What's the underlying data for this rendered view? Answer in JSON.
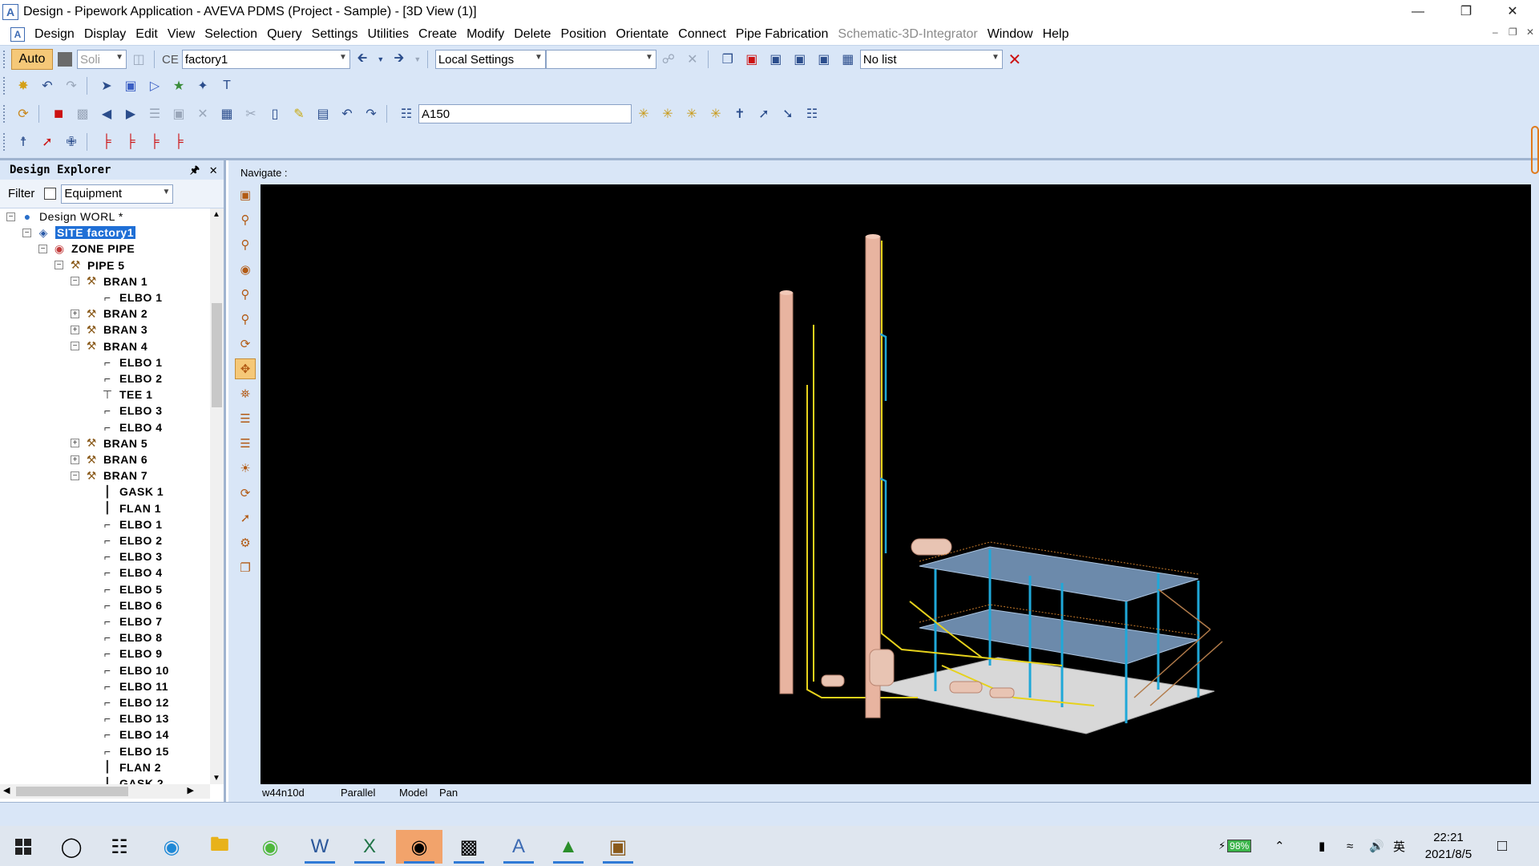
{
  "window": {
    "title": "Design - Pipework Application  - AVEVA PDMS (Project - Sample) - [3D View (1)]",
    "app_icon_letter": "A"
  },
  "menu": {
    "items": [
      "Design",
      "Display",
      "Edit",
      "View",
      "Selection",
      "Query",
      "Settings",
      "Utilities",
      "Create",
      "Modify",
      "Delete",
      "Position",
      "Orientate",
      "Connect",
      "Pipe Fabrication",
      "Schematic-3D-Integrator",
      "Window",
      "Help"
    ],
    "disabled": [
      "Schematic-3D-Integrator"
    ]
  },
  "toolbar": {
    "auto_label": "Auto",
    "solid_value": "Soli",
    "ce_label": "CE",
    "ce_value": "factory1",
    "local_settings_value": "Local Settings",
    "empty_combo_value": "",
    "list_value": "No list",
    "spec_value": "A150"
  },
  "explorer": {
    "title": "Design Explorer",
    "filter_label": "Filter",
    "filter_value": "Equipment",
    "tree": [
      {
        "label": "Design WORL *",
        "level": 0,
        "exp": "-",
        "icon": "globe",
        "plain": true
      },
      {
        "label": "SITE factory1",
        "level": 1,
        "exp": "-",
        "icon": "site",
        "selected": true
      },
      {
        "label": "ZONE PIPE",
        "level": 2,
        "exp": "-",
        "icon": "zone"
      },
      {
        "label": "PIPE 5",
        "level": 3,
        "exp": "-",
        "icon": "pipe"
      },
      {
        "label": "BRAN 1",
        "level": 4,
        "exp": "-",
        "icon": "pipe"
      },
      {
        "label": "ELBO 1",
        "level": 5,
        "exp": "",
        "icon": "elbo"
      },
      {
        "label": "BRAN 2",
        "level": 4,
        "exp": "+",
        "icon": "pipe"
      },
      {
        "label": "BRAN 3",
        "level": 4,
        "exp": "+",
        "icon": "pipe"
      },
      {
        "label": "BRAN 4",
        "level": 4,
        "exp": "-",
        "icon": "pipe"
      },
      {
        "label": "ELBO 1",
        "level": 5,
        "exp": "",
        "icon": "elbo"
      },
      {
        "label": "ELBO 2",
        "level": 5,
        "exp": "",
        "icon": "elbo"
      },
      {
        "label": "TEE 1",
        "level": 5,
        "exp": "",
        "icon": "tee"
      },
      {
        "label": "ELBO 3",
        "level": 5,
        "exp": "",
        "icon": "elbo"
      },
      {
        "label": "ELBO 4",
        "level": 5,
        "exp": "",
        "icon": "elbo"
      },
      {
        "label": "BRAN 5",
        "level": 4,
        "exp": "+",
        "icon": "pipe"
      },
      {
        "label": "BRAN 6",
        "level": 4,
        "exp": "+",
        "icon": "pipe"
      },
      {
        "label": "BRAN 7",
        "level": 4,
        "exp": "-",
        "icon": "pipe"
      },
      {
        "label": "GASK 1",
        "level": 5,
        "exp": "",
        "icon": "gask"
      },
      {
        "label": "FLAN 1",
        "level": 5,
        "exp": "",
        "icon": "gask"
      },
      {
        "label": "ELBO 1",
        "level": 5,
        "exp": "",
        "icon": "elbo"
      },
      {
        "label": "ELBO 2",
        "level": 5,
        "exp": "",
        "icon": "elbo"
      },
      {
        "label": "ELBO 3",
        "level": 5,
        "exp": "",
        "icon": "elbo"
      },
      {
        "label": "ELBO 4",
        "level": 5,
        "exp": "",
        "icon": "elbo"
      },
      {
        "label": "ELBO 5",
        "level": 5,
        "exp": "",
        "icon": "elbo"
      },
      {
        "label": "ELBO 6",
        "level": 5,
        "exp": "",
        "icon": "elbo"
      },
      {
        "label": "ELBO 7",
        "level": 5,
        "exp": "",
        "icon": "elbo"
      },
      {
        "label": "ELBO 8",
        "level": 5,
        "exp": "",
        "icon": "elbo"
      },
      {
        "label": "ELBO 9",
        "level": 5,
        "exp": "",
        "icon": "elbo"
      },
      {
        "label": "ELBO 10",
        "level": 5,
        "exp": "",
        "icon": "elbo"
      },
      {
        "label": "ELBO 11",
        "level": 5,
        "exp": "",
        "icon": "elbo"
      },
      {
        "label": "ELBO 12",
        "level": 5,
        "exp": "",
        "icon": "elbo"
      },
      {
        "label": "ELBO 13",
        "level": 5,
        "exp": "",
        "icon": "elbo"
      },
      {
        "label": "ELBO 14",
        "level": 5,
        "exp": "",
        "icon": "elbo"
      },
      {
        "label": "ELBO 15",
        "level": 5,
        "exp": "",
        "icon": "elbo"
      },
      {
        "label": "FLAN 2",
        "level": 5,
        "exp": "",
        "icon": "gask"
      },
      {
        "label": "GASK 2",
        "level": 5,
        "exp": "",
        "icon": "gask"
      }
    ]
  },
  "view": {
    "navigate_label": "Navigate :",
    "status": {
      "view_name": "w44n10d",
      "projection": "Parallel",
      "mode": "Model",
      "action": "Pan"
    }
  },
  "taskbar": {
    "battery": "98%",
    "ime": "英",
    "time": "22:21",
    "date": "2021/8/5"
  },
  "colors": {
    "ui_blue": "#d9e6f7",
    "selection": "#1f6fd6",
    "viewport": "#000000",
    "column_pink": "#e8b4a0",
    "structure_cyan": "#1fa8d8",
    "pipe_yellow": "#e6d21c"
  }
}
